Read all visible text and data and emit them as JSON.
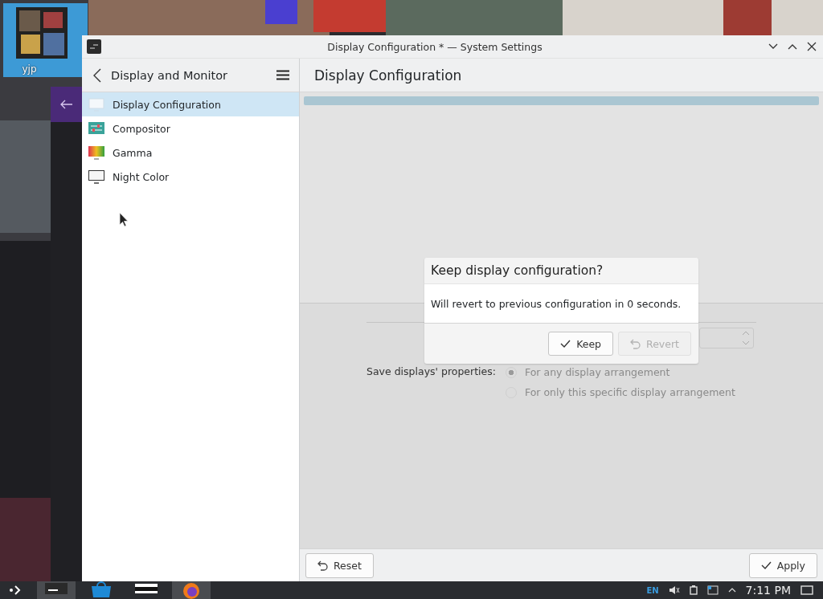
{
  "desktop": {
    "kind": "picture",
    "icons": [
      {
        "label": "yjp",
        "selected": true
      }
    ]
  },
  "window": {
    "title": "Display Configuration * — System Settings"
  },
  "sidebar": {
    "title": "Display and Monitor",
    "items": [
      {
        "label": "Display Configuration",
        "kind": "monitor",
        "selected": true
      },
      {
        "label": "Compositor",
        "kind": "compositor",
        "selected": false
      },
      {
        "label": "Gamma",
        "kind": "gamma",
        "selected": false
      },
      {
        "label": "Night Color",
        "kind": "night",
        "selected": false
      }
    ]
  },
  "page": {
    "title": "Display Configuration",
    "save_label": "Save displays' properties:",
    "options": [
      {
        "label": "For any display arrangement",
        "selected": true
      },
      {
        "label": "For only this specific display arrangement",
        "selected": false
      }
    ]
  },
  "dialog": {
    "title": "Keep display configuration?",
    "message": "Will revert to previous configuration in 0 seconds.",
    "buttons": [
      {
        "label": "Keep",
        "kind": "check",
        "disabled": false
      },
      {
        "label": "Revert",
        "kind": "undo",
        "disabled": true
      }
    ]
  },
  "footer": {
    "buttons": [
      {
        "label": "Reset",
        "kind": "undo"
      },
      {
        "label": "Apply",
        "kind": "check"
      }
    ]
  },
  "taskbar": {
    "tasks": [
      {
        "kind": "terminal",
        "active": true
      },
      {
        "kind": "store",
        "active": false
      },
      {
        "kind": "window",
        "active": false
      },
      {
        "kind": "browser",
        "active": true
      }
    ],
    "language": "EN",
    "clock": "7:11 PM"
  }
}
